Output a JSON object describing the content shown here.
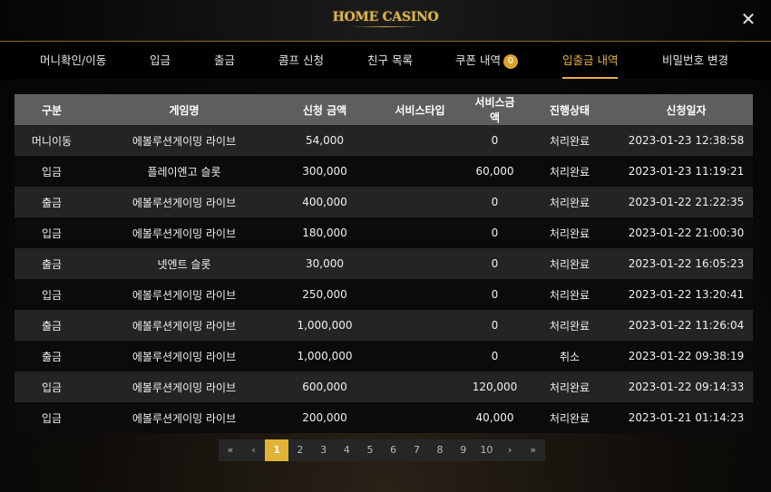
{
  "header": {
    "logo_text": "HOME CASINO",
    "close_label": "✕"
  },
  "tabs": [
    {
      "label": "머니확인/이동",
      "active": false
    },
    {
      "label": "입금",
      "active": false
    },
    {
      "label": "출금",
      "active": false
    },
    {
      "label": "콤프 신청",
      "active": false
    },
    {
      "label": "친구 목록",
      "active": false
    },
    {
      "label": "쿠폰 내역",
      "active": false,
      "badge": "0"
    },
    {
      "label": "입출금 내역",
      "active": true
    },
    {
      "label": "비밀번호 변경",
      "active": false
    }
  ],
  "table": {
    "columns": [
      "구분",
      "게임명",
      "신청 금액",
      "서비스타입",
      "서비스금액",
      "진행상태",
      "신청일자"
    ],
    "rows": [
      [
        "머니이동",
        "에볼루션게이밍 라이브",
        "54,000",
        "",
        "0",
        "처리완료",
        "2023-01-23 12:38:58"
      ],
      [
        "입금",
        "플레이엔고 슬롯",
        "300,000",
        "",
        "60,000",
        "처리완료",
        "2023-01-23 11:19:21"
      ],
      [
        "출금",
        "에볼루션게이밍 라이브",
        "400,000",
        "",
        "0",
        "처리완료",
        "2023-01-22 21:22:35"
      ],
      [
        "입금",
        "에볼루션게이밍 라이브",
        "180,000",
        "",
        "0",
        "처리완료",
        "2023-01-22 21:00:30"
      ],
      [
        "출금",
        "넷엔트 슬롯",
        "30,000",
        "",
        "0",
        "처리완료",
        "2023-01-22 16:05:23"
      ],
      [
        "입금",
        "에볼루션게이밍 라이브",
        "250,000",
        "",
        "0",
        "처리완료",
        "2023-01-22 13:20:41"
      ],
      [
        "출금",
        "에볼루션게이밍 라이브",
        "1,000,000",
        "",
        "0",
        "처리완료",
        "2023-01-22 11:26:04"
      ],
      [
        "출금",
        "에볼루션게이밍 라이브",
        "1,000,000",
        "",
        "0",
        "취소",
        "2023-01-22 09:38:19"
      ],
      [
        "입금",
        "에볼루션게이밍 라이브",
        "600,000",
        "",
        "120,000",
        "처리완료",
        "2023-01-22 09:14:33"
      ],
      [
        "입금",
        "에볼루션게이밍 라이브",
        "200,000",
        "",
        "40,000",
        "처리완료",
        "2023-01-21 01:14:23"
      ]
    ]
  },
  "pagination": {
    "first": "«",
    "prev": "‹",
    "pages": [
      "1",
      "2",
      "3",
      "4",
      "5",
      "6",
      "7",
      "8",
      "9",
      "10"
    ],
    "current": "1",
    "next": "›",
    "last": "»"
  },
  "colors": {
    "accent": "#e8b04a",
    "badge": "#d9a230",
    "page_active": "#e0b237",
    "header_row": "#5e5e5e"
  }
}
